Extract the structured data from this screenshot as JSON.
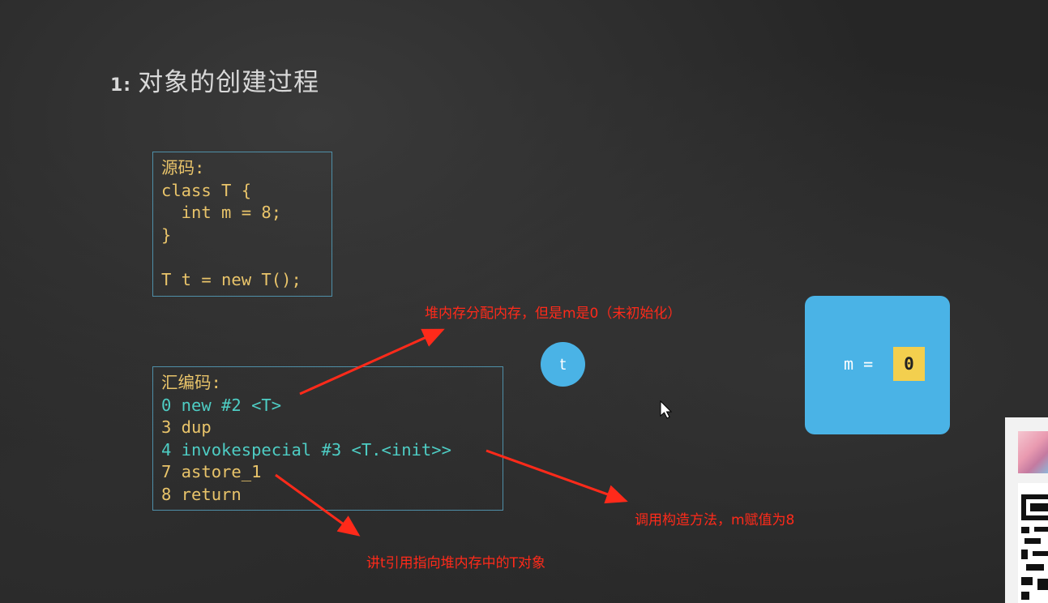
{
  "heading": {
    "number": "1:",
    "title": "对象的创建过程"
  },
  "source": {
    "lines": [
      "源码:",
      "class T {",
      "  int m = 8;",
      "}",
      "",
      "T t = new T();"
    ]
  },
  "assembly": {
    "lines": [
      "汇编码:",
      "0 new #2 <T>",
      "3 dup",
      "4 invokespecial #3 <T.<init>>",
      "7 astore_1",
      "8 return"
    ]
  },
  "annotations": {
    "alloc": "堆内存分配内存，但是m是0（未初始化）",
    "ctor": "调用构造方法，m赋值为8",
    "astore": "讲t引用指向堆内存中的T对象"
  },
  "ref_variable": "t",
  "heap_object": {
    "field_label": "m =",
    "field_value": "0"
  },
  "colors": {
    "background": "#262626",
    "code": "#e9c46a",
    "box_border": "#4f8fa8",
    "arrow": "#ff2a1a",
    "object": "#4ab3e6",
    "value_box": "#f3cf4e"
  }
}
